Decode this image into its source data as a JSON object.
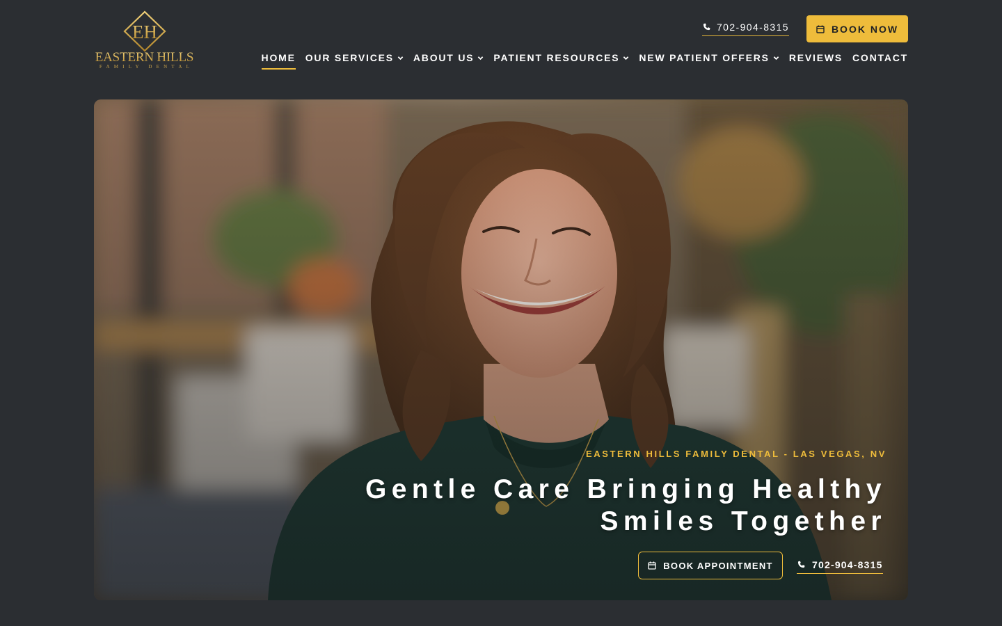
{
  "brand": {
    "monogram": "EH",
    "name": "EASTERN HILLS",
    "tagline": "FAMILY DENTAL",
    "gold": "#eebc3b"
  },
  "header": {
    "phone": "702-904-8315",
    "book_now": "BOOK NOW"
  },
  "nav": {
    "items": [
      {
        "label": "HOME",
        "dropdown": false,
        "active": true
      },
      {
        "label": "OUR SERVICES",
        "dropdown": true
      },
      {
        "label": "ABOUT US",
        "dropdown": true
      },
      {
        "label": "PATIENT RESOURCES",
        "dropdown": true
      },
      {
        "label": "NEW PATIENT OFFERS",
        "dropdown": true
      },
      {
        "label": "REVIEWS",
        "dropdown": false
      },
      {
        "label": "CONTACT",
        "dropdown": false
      }
    ]
  },
  "hero": {
    "eyebrow": "EASTERN HILLS FAMILY DENTAL - LAS VEGAS, NV",
    "title_line1": "Gentle Care Bringing Healthy",
    "title_line2": "Smiles Together",
    "book_appointment": "BOOK APPOINTMENT",
    "phone": "702-904-8315",
    "image": "smiling-woman-photo"
  },
  "icons": {
    "phone": "phone-icon",
    "calendar": "calendar-icon",
    "chevron": "chevron-down-icon"
  }
}
